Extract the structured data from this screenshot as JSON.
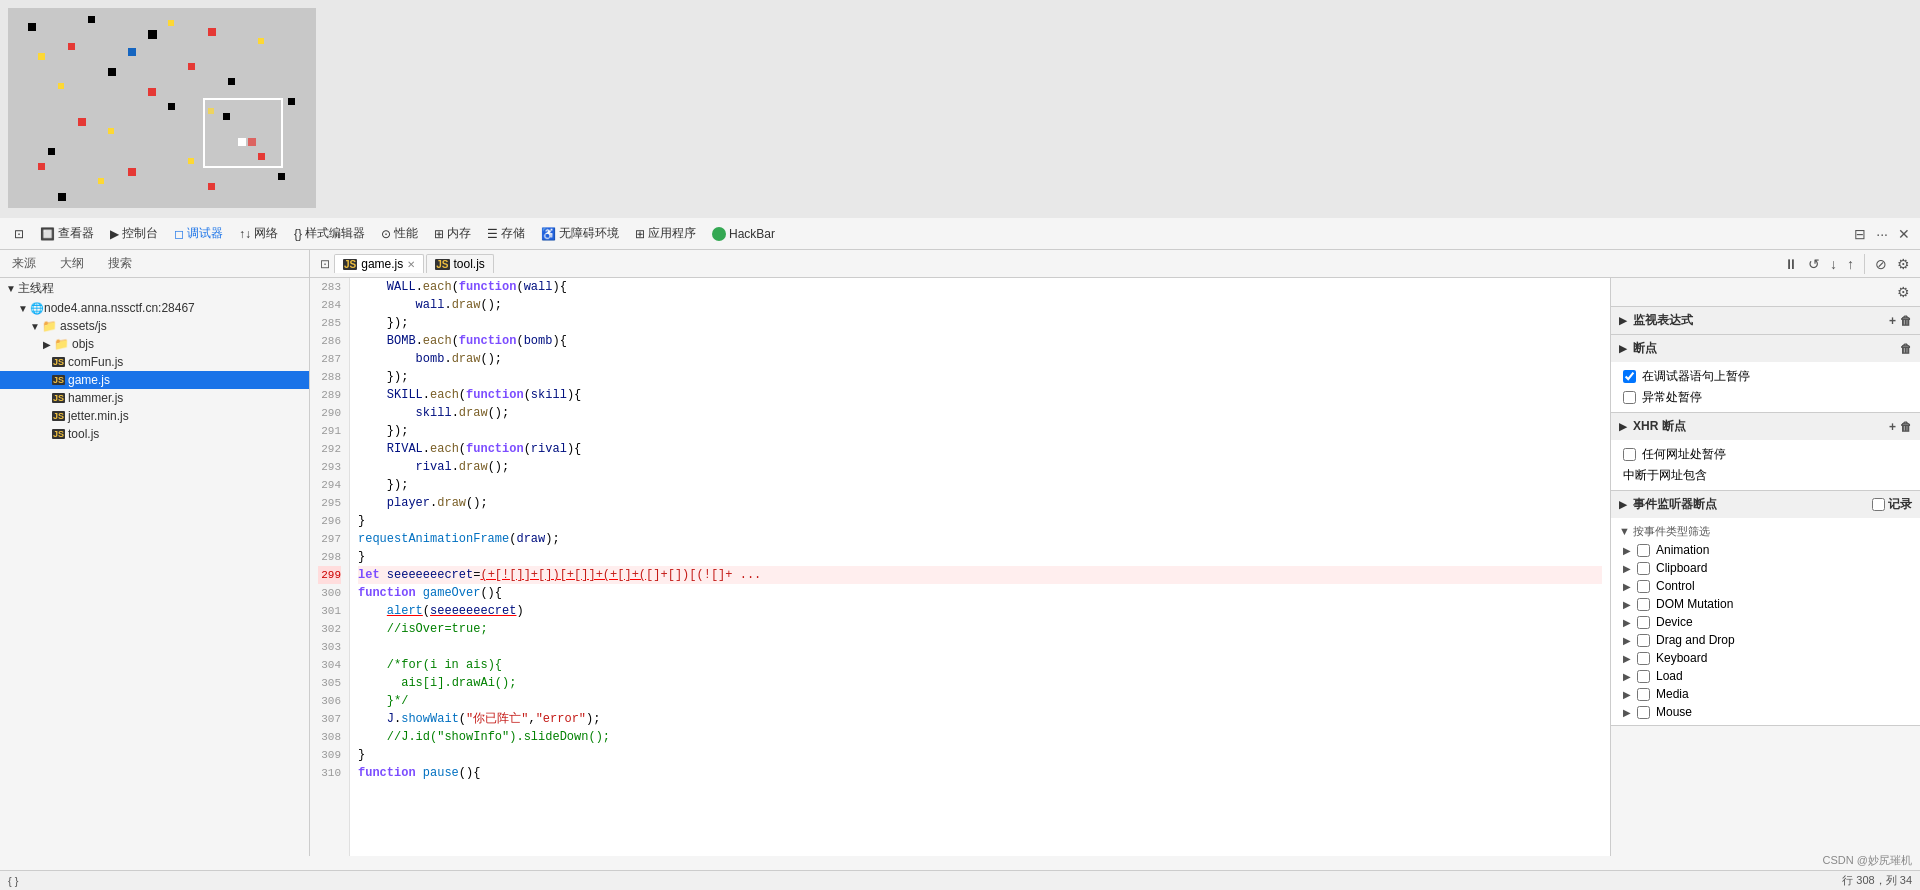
{
  "preview": {
    "label": "Game Preview"
  },
  "toolbar": {
    "items": [
      {
        "id": "inspector",
        "label": "查看器",
        "icon": "🔲"
      },
      {
        "id": "console",
        "label": "控制台",
        "icon": "▶"
      },
      {
        "id": "debugger",
        "label": "调试器",
        "icon": "◻"
      },
      {
        "id": "network",
        "label": "网络",
        "icon": "↑↓"
      },
      {
        "id": "style-editor",
        "label": "样式编辑器",
        "icon": "{}"
      },
      {
        "id": "performance",
        "label": "性能",
        "icon": "⊙"
      },
      {
        "id": "memory",
        "label": "内存",
        "icon": "⊞"
      },
      {
        "id": "storage",
        "label": "存储",
        "icon": "☰"
      },
      {
        "id": "accessibility",
        "label": "无障碍环境",
        "icon": "♿"
      },
      {
        "id": "applications",
        "label": "应用程序",
        "icon": "⊞"
      },
      {
        "id": "hackbar",
        "label": "HackBar",
        "icon": "●"
      }
    ],
    "active": "调试器"
  },
  "sub_header": {
    "left_tabs": [
      "来源",
      "大纲",
      "搜索"
    ],
    "files": [
      {
        "name": "game.js",
        "active": true
      },
      {
        "name": "tool.js",
        "active": false
      }
    ]
  },
  "file_tree": {
    "items": [
      {
        "id": "main-thread",
        "label": "主线程",
        "indent": 0,
        "type": "thread",
        "expanded": true
      },
      {
        "id": "node-host",
        "label": "node4.anna.nssctf.cn:28467",
        "indent": 1,
        "type": "host",
        "expanded": true
      },
      {
        "id": "assets-folder",
        "label": "assets/js",
        "indent": 2,
        "type": "folder",
        "expanded": true
      },
      {
        "id": "objs-folder",
        "label": "objs",
        "indent": 3,
        "type": "folder",
        "expanded": false
      },
      {
        "id": "comfun",
        "label": "comFun.js",
        "indent": 3,
        "type": "js"
      },
      {
        "id": "gamejs",
        "label": "game.js",
        "indent": 3,
        "type": "js",
        "selected": true
      },
      {
        "id": "hammerjs",
        "label": "hammer.js",
        "indent": 3,
        "type": "js"
      },
      {
        "id": "jetter",
        "label": "jetter.min.js",
        "indent": 3,
        "type": "js"
      },
      {
        "id": "tooljs",
        "label": "tool.js",
        "indent": 3,
        "type": "js"
      }
    ]
  },
  "code": {
    "lines": [
      {
        "num": 283,
        "text": "    WALL.each(function(wall){",
        "type": "normal"
      },
      {
        "num": 284,
        "text": "        wall.draw();",
        "type": "normal"
      },
      {
        "num": 285,
        "text": "    });",
        "type": "normal"
      },
      {
        "num": 286,
        "text": "    BOMB.each(function(bomb){",
        "type": "normal"
      },
      {
        "num": 287,
        "text": "        bomb.draw();",
        "type": "normal"
      },
      {
        "num": 288,
        "text": "    });",
        "type": "normal"
      },
      {
        "num": 289,
        "text": "    SKILL.each(function(skill){",
        "type": "normal"
      },
      {
        "num": 290,
        "text": "        skill.draw();",
        "type": "normal"
      },
      {
        "num": 291,
        "text": "    });",
        "type": "normal"
      },
      {
        "num": 292,
        "text": "    RIVAL.each(function(rival){",
        "type": "normal"
      },
      {
        "num": 293,
        "text": "        rival.draw();",
        "type": "normal"
      },
      {
        "num": 294,
        "text": "    });",
        "type": "normal"
      },
      {
        "num": 295,
        "text": "    player.draw();",
        "type": "normal"
      },
      {
        "num": 296,
        "text": "}",
        "type": "normal"
      },
      {
        "num": 297,
        "text": "requestAnimationFrame(draw);",
        "type": "normal"
      },
      {
        "num": 298,
        "text": "}",
        "type": "normal"
      },
      {
        "num": 299,
        "text": "let seeeeeeecret=(+[![]]+[])[+[]]+(+[]+([]+[])[(![]+ ...long line...",
        "type": "breakpoint"
      },
      {
        "num": 300,
        "text": "function gameOver(){",
        "type": "normal"
      },
      {
        "num": 301,
        "text": "    alert(seeeeeeecret)",
        "type": "normal"
      },
      {
        "num": 302,
        "text": "    //isOver=true;",
        "type": "normal"
      },
      {
        "num": 303,
        "text": "",
        "type": "normal"
      },
      {
        "num": 304,
        "text": "    /*for(i in ais){",
        "type": "normal"
      },
      {
        "num": 305,
        "text": "      ais[i].drawAi();",
        "type": "normal"
      },
      {
        "num": 306,
        "text": "    }*/",
        "type": "normal"
      },
      {
        "num": 307,
        "text": "    J.showWait(\"你已阵亡\",\"error\");",
        "type": "normal"
      },
      {
        "num": 308,
        "text": "    //J.id(\"showInfo\").slideDown();",
        "type": "normal"
      },
      {
        "num": 309,
        "text": "}",
        "type": "normal"
      },
      {
        "num": 310,
        "text": "function pause(){",
        "type": "normal"
      }
    ]
  },
  "right_panel": {
    "watch_title": "监视表达式",
    "breakpoints_title": "断点",
    "xhr_title": "XHR 断点",
    "event_title": "事件监听器断点",
    "breakpoints": [
      {
        "label": "在调试器语句上暂停",
        "checked": true
      },
      {
        "label": "异常处暂停",
        "checked": false
      }
    ],
    "xhr_breakpoints": [
      {
        "label": "任何网址处暂停",
        "checked": false
      },
      {
        "label": "中断于网址包含",
        "value": ""
      }
    ],
    "event_log_label": "记录",
    "event_filter_label": "▼ 按事件类型筛选",
    "events": [
      {
        "label": "Animation",
        "checked": false,
        "expanded": false
      },
      {
        "label": "Clipboard",
        "checked": false,
        "expanded": false
      },
      {
        "label": "Control",
        "checked": false,
        "expanded": false
      },
      {
        "label": "DOM Mutation",
        "checked": false,
        "expanded": false
      },
      {
        "label": "Device",
        "checked": false,
        "expanded": false
      },
      {
        "label": "Drag and Drop",
        "checked": false,
        "expanded": false
      },
      {
        "label": "Keyboard",
        "checked": false,
        "expanded": false
      },
      {
        "label": "Load",
        "checked": false,
        "expanded": false
      },
      {
        "label": "Media",
        "checked": false,
        "expanded": false
      },
      {
        "label": "Mouse",
        "checked": false,
        "expanded": false
      }
    ]
  },
  "status_bar": {
    "left": "{ }",
    "position": "行 308，列 34",
    "watermark": "CSDN @妙尻璀机"
  }
}
